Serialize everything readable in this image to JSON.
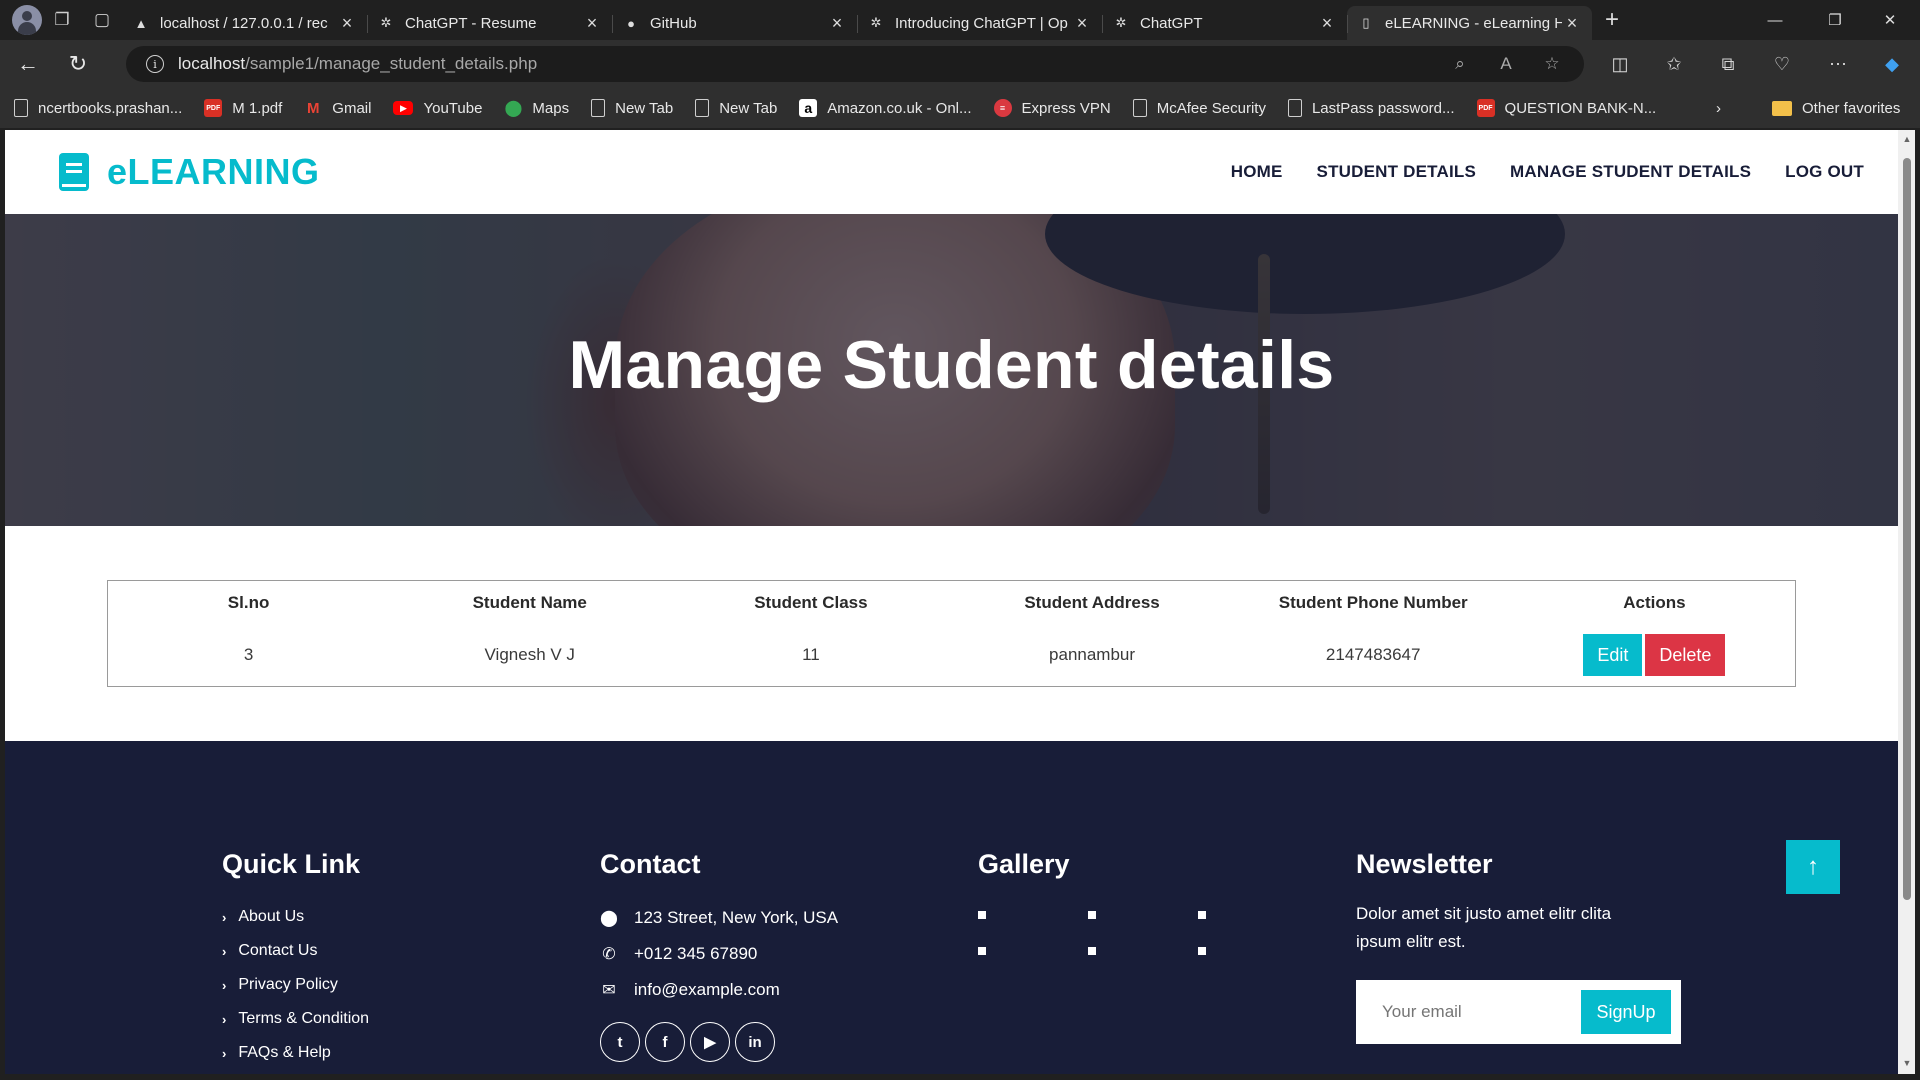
{
  "browser": {
    "tabs": [
      {
        "title": "localhost / 127.0.0.1 / rec",
        "favicon": "phpmyadmin-icon",
        "active": false
      },
      {
        "title": "ChatGPT - Resume",
        "favicon": "openai-icon",
        "active": false
      },
      {
        "title": "GitHub",
        "favicon": "github-icon",
        "active": false
      },
      {
        "title": "Introducing ChatGPT | Op",
        "favicon": "openai-icon",
        "active": false
      },
      {
        "title": "ChatGPT",
        "favicon": "openai-icon",
        "active": false
      },
      {
        "title": "eLEARNING - eLearning H",
        "favicon": "page-icon",
        "active": true
      }
    ],
    "url_host": "localhost",
    "url_path": "/sample1/manage_student_details.php",
    "bookmarks": [
      {
        "label": "ncertbooks.prashan...",
        "icon": "doc"
      },
      {
        "label": "M 1.pdf",
        "icon": "pdf"
      },
      {
        "label": "Gmail",
        "icon": "gmail"
      },
      {
        "label": "YouTube",
        "icon": "youtube"
      },
      {
        "label": "Maps",
        "icon": "maps"
      },
      {
        "label": "New Tab",
        "icon": "doc"
      },
      {
        "label": "New Tab",
        "icon": "doc"
      },
      {
        "label": "Amazon.co.uk - Onl...",
        "icon": "amazon"
      },
      {
        "label": "Express VPN",
        "icon": "vpn"
      },
      {
        "label": "McAfee Security",
        "icon": "doc"
      },
      {
        "label": "LastPass password...",
        "icon": "doc"
      },
      {
        "label": "QUESTION BANK-N...",
        "icon": "pdf"
      }
    ],
    "other_favorites": "Other favorites"
  },
  "site": {
    "brand": "eLEARNING",
    "nav": [
      "HOME",
      "STUDENT DETAILS",
      "MANAGE STUDENT DETAILS",
      "LOG OUT"
    ],
    "hero_title": "Manage Student details",
    "table": {
      "headers": [
        "Sl.no",
        "Student Name",
        "Student Class",
        "Student Address",
        "Student Phone Number",
        "Actions"
      ],
      "rows": [
        {
          "slno": "3",
          "name": "Vignesh V J",
          "class": "11",
          "address": "pannambur",
          "phone": "2147483647"
        }
      ],
      "edit_label": "Edit",
      "delete_label": "Delete"
    },
    "footer": {
      "quick_link": {
        "title": "Quick Link",
        "items": [
          "About Us",
          "Contact Us",
          "Privacy Policy",
          "Terms & Condition",
          "FAQs & Help"
        ]
      },
      "contact": {
        "title": "Contact",
        "address": "123 Street, New York, USA",
        "phone": "+012 345 67890",
        "email": "info@example.com"
      },
      "gallery": {
        "title": "Gallery"
      },
      "newsletter": {
        "title": "Newsletter",
        "text": "Dolor amet sit justo amet elitr clita ipsum elitr est.",
        "placeholder": "Your email",
        "button": "SignUp"
      }
    }
  },
  "colors": {
    "accent": "#06BBCC",
    "dark": "#181d38",
    "danger": "#dc3545"
  }
}
